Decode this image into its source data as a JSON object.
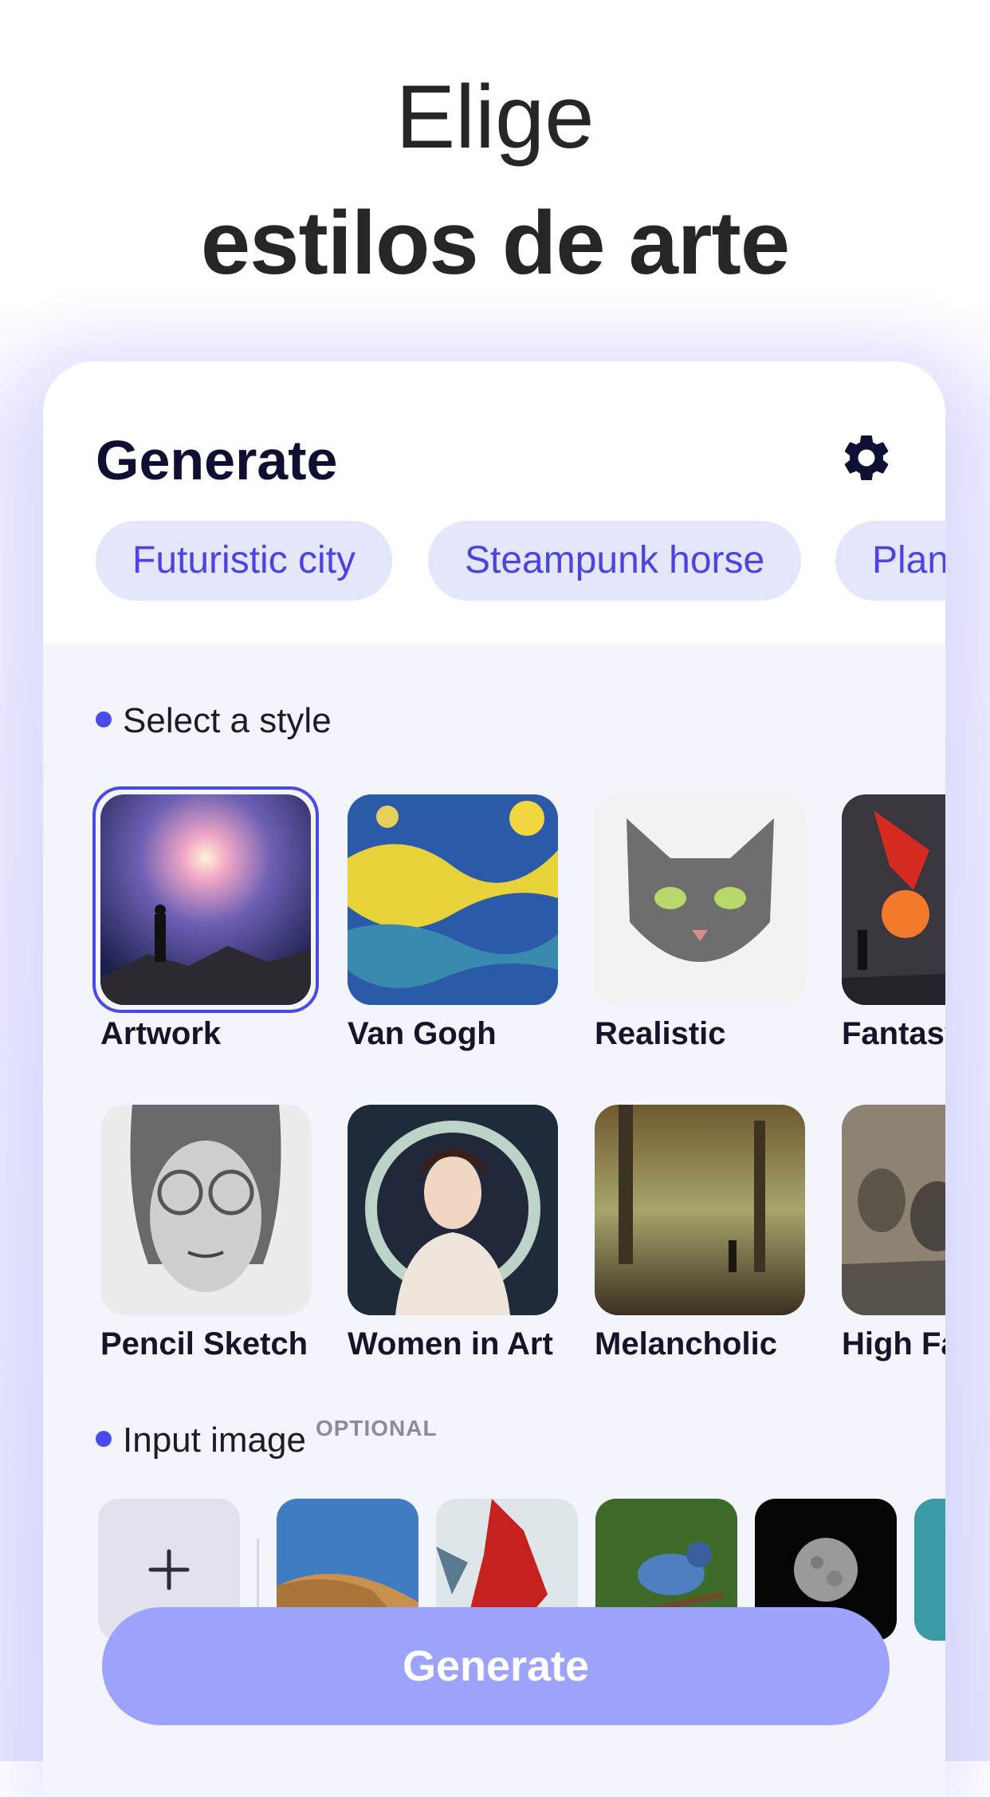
{
  "headline": {
    "line1": "Elige",
    "line2": "estilos de arte"
  },
  "card": {
    "title": "Generate",
    "settings_icon": "gear-icon",
    "prompts": [
      "Futuristic city",
      "Steampunk horse",
      "Plan"
    ],
    "style_section_label": "Select a style",
    "styles": [
      {
        "label": "Artwork",
        "selected": true
      },
      {
        "label": "Van Gogh",
        "selected": false
      },
      {
        "label": "Realistic",
        "selected": false
      },
      {
        "label": "Fantasy",
        "selected": false
      },
      {
        "label": "Pencil Sketch",
        "selected": false
      },
      {
        "label": "Women in Art",
        "selected": false
      },
      {
        "label": "Melancholic",
        "selected": false
      },
      {
        "label": "High Fa",
        "selected": false
      }
    ],
    "input_section_label": "Input image",
    "input_optional": "OPTIONAL",
    "add_image_icon": "plus-icon",
    "generate_button": "Generate"
  },
  "colors": {
    "accent": "#4a4ae6",
    "chip_bg": "#e4e6fb",
    "button_bg": "#9da3fb",
    "title": "#0e0f33"
  }
}
